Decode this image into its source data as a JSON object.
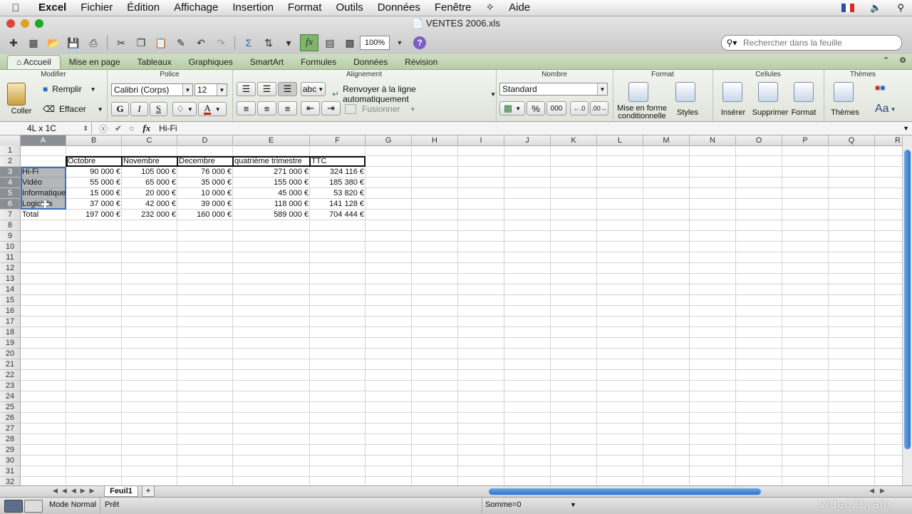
{
  "menubar": {
    "apple": "",
    "app": "Excel",
    "items": [
      "Fichier",
      "Édition",
      "Affichage",
      "Insertion",
      "Format",
      "Outils",
      "Données",
      "Fenêtre",
      "Aide"
    ]
  },
  "window": {
    "title": "VENTES 2006.xls"
  },
  "toolbar": {
    "zoom": "100%",
    "search_placeholder": "Rechercher dans la feuille"
  },
  "ribbon": {
    "tabs": [
      "Accueil",
      "Mise en page",
      "Tableaux",
      "Graphiques",
      "SmartArt",
      "Formules",
      "Données",
      "Révision"
    ],
    "groups": {
      "modifier": "Modifier",
      "police": "Police",
      "alignement": "Alignement",
      "nombre": "Nombre",
      "format": "Format",
      "cellules": "Cellules",
      "themes": "Thèmes"
    },
    "coller": "Coller",
    "remplir": "Remplir",
    "effacer": "Effacer",
    "font": "Calibri (Corps)",
    "size": "12",
    "bold": "G",
    "italic": "I",
    "underline": "S",
    "wrap": "Renvoyer à la ligne automatiquement",
    "merge": "Fusionner",
    "abc": "abc",
    "numformat": "Standard",
    "percent": "%",
    "thousands": "000",
    "cond_format_1": "Mise en forme",
    "cond_format_2": "conditionnelle",
    "styles": "Styles",
    "inserer": "Insérer",
    "supprimer": "Supprimer",
    "format_btn": "Format",
    "themes_btn": "Thèmes",
    "aa": "Aa"
  },
  "formula_bar": {
    "name_box": "4L x 1C",
    "fx": "fx",
    "value": "Hi-Fi"
  },
  "columns": [
    "A",
    "B",
    "C",
    "D",
    "E",
    "F",
    "G",
    "H",
    "I",
    "J",
    "K",
    "L",
    "M",
    "N",
    "O",
    "P",
    "Q",
    "R"
  ],
  "rows": [
    "1",
    "2",
    "3",
    "4",
    "5",
    "6",
    "7",
    "8",
    "9",
    "10",
    "11",
    "12",
    "13",
    "14",
    "15",
    "16",
    "17",
    "18",
    "19",
    "20",
    "21",
    "22",
    "23",
    "24",
    "25",
    "26",
    "27",
    "28",
    "29",
    "30",
    "31",
    "32"
  ],
  "sheet": {
    "headers": [
      "Octobre",
      "Novembre",
      "Decembre",
      "quatrième trimestre",
      "TTC"
    ],
    "rows": [
      {
        "label": "Hi-Fi",
        "values": [
          "90 000 €",
          "105 000 €",
          "76 000 €",
          "271 000 €",
          "324 116 €"
        ]
      },
      {
        "label": "Vidéo",
        "values": [
          "55 000 €",
          "65 000 €",
          "35 000 €",
          "155 000 €",
          "185 380 €"
        ]
      },
      {
        "label": "Informatique",
        "values": [
          "15 000 €",
          "20 000 €",
          "10 000 €",
          "45 000 €",
          "53 820 €"
        ]
      },
      {
        "label": "Logiciels",
        "values": [
          "37 000 €",
          "42 000 €",
          "39 000 €",
          "118 000 €",
          "141 128 €"
        ]
      },
      {
        "label": "Total",
        "values": [
          "197 000 €",
          "232 000 €",
          "160 000 €",
          "589 000 €",
          "704 444 €"
        ]
      }
    ]
  },
  "sheet_tabs": [
    "Feuil1"
  ],
  "status": {
    "view": "Mode Normal",
    "ready": "Prêt",
    "sum": "Somme=0"
  },
  "watermark": "video2brain"
}
